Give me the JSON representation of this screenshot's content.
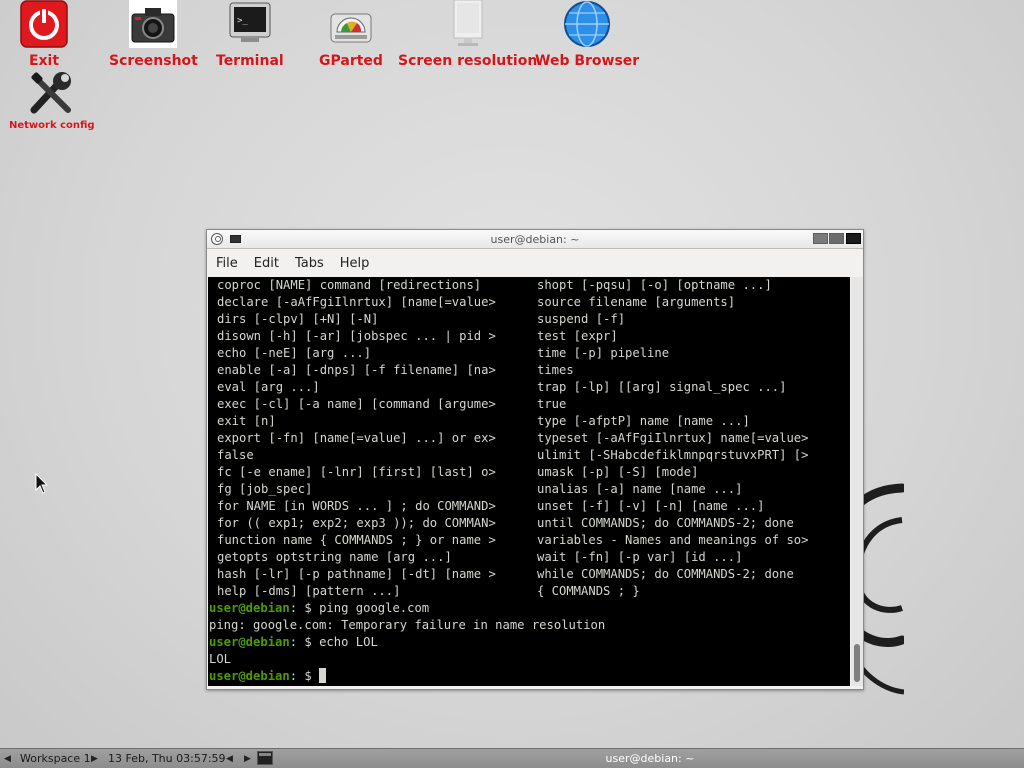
{
  "desktop": {
    "icons": [
      {
        "label": "Exit",
        "icon": "power-icon"
      },
      {
        "label": "Screenshot",
        "icon": "camera-icon"
      },
      {
        "label": "Terminal",
        "icon": "terminal-icon"
      },
      {
        "label": "GParted",
        "icon": "disk-icon"
      },
      {
        "label": "Screen resolution",
        "icon": "monitor-icon"
      },
      {
        "label": "Web Browser",
        "icon": "globe-icon"
      },
      {
        "label": "Network config",
        "icon": "tools-icon"
      }
    ]
  },
  "window": {
    "title": "user@debian: ~",
    "menu": [
      "File",
      "Edit",
      "Tabs",
      "Help"
    ]
  },
  "terminal": {
    "help_left": [
      "coproc [NAME] command [redirections]",
      "declare [-aAfFgiIlnrtux] [name[=value>",
      "dirs [-clpv] [+N] [-N]",
      "disown [-h] [-ar] [jobspec ... | pid >",
      "echo [-neE] [arg ...]",
      "enable [-a] [-dnps] [-f filename] [na>",
      "eval [arg ...]",
      "exec [-cl] [-a name] [command [argume>",
      "exit [n]",
      "export [-fn] [name[=value] ...] or ex>",
      "false",
      "fc [-e ename] [-lnr] [first] [last] o>",
      "fg [job_spec]",
      "for NAME [in WORDS ... ] ; do COMMAND>",
      "for (( exp1; exp2; exp3 )); do COMMAN>",
      "function name { COMMANDS ; } or name >",
      "getopts optstring name [arg ...]",
      "hash [-lr] [-p pathname] [-dt] [name >",
      "help [-dms] [pattern ...]"
    ],
    "help_right": [
      "shopt [-pqsu] [-o] [optname ...]",
      "source filename [arguments]",
      "suspend [-f]",
      "test [expr]",
      "time [-p] pipeline",
      "times",
      "trap [-lp] [[arg] signal_spec ...]",
      "true",
      "type [-afptP] name [name ...]",
      "typeset [-aAfFgiIlnrtux] name[=value>",
      "ulimit [-SHabcdefiklmnpqrstuvxPRT] [>",
      "umask [-p] [-S] [mode]",
      "unalias [-a] name [name ...]",
      "unset [-f] [-v] [-n] [name ...]",
      "until COMMANDS; do COMMANDS-2; done",
      "variables - Names and meanings of so>",
      "wait [-fn] [-p var] [id ...]",
      "while COMMANDS; do COMMANDS-2; done",
      "{ COMMANDS ; }"
    ],
    "prompt_user": "user@debian",
    "prompt_path": ":",
    "prompt_sym": " $ ",
    "cmd1": "ping google.com",
    "out1": "ping: google.com: Temporary failure in name resolution",
    "cmd2": "echo LOL",
    "out2": "LOL"
  },
  "taskbar": {
    "workspace": "Workspace 1",
    "clock": "13 Feb, Thu 03:57:59",
    "window_title": "user@debian: ~"
  },
  "colors": {
    "icon_label": "#d4161b",
    "prompt_user": "#4e9a06",
    "prompt_path": "#3465a4",
    "terminal_bg": "#000000",
    "terminal_fg": "#d3d7cf"
  }
}
